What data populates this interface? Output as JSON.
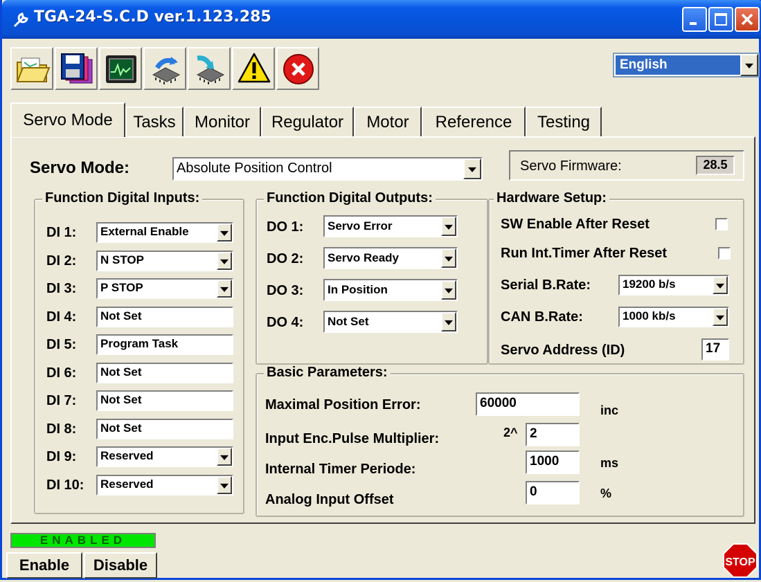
{
  "window": {
    "title": "TGA-24-S.C.D  ver.1.123.285"
  },
  "toolbar": {
    "icons": [
      "open-folder-icon",
      "save-icon",
      "scope-monitor-icon",
      "upload-chip-icon",
      "download-chip-icon",
      "warning-icon",
      "error-icon"
    ]
  },
  "language": {
    "selected": "English"
  },
  "tabs": [
    "Servo Mode",
    "Tasks",
    "Monitor",
    "Regulator",
    "Motor",
    "Reference",
    "Testing"
  ],
  "servo_mode": {
    "label": "Servo Mode:",
    "value": "Absolute Position Control",
    "firmware_label": "Servo Firmware:",
    "firmware_value": "28.5"
  },
  "digital_inputs": {
    "title": "Function Digital Inputs:",
    "items": [
      {
        "label": "DI 1:",
        "value": "External Enable",
        "type": "combo"
      },
      {
        "label": "DI 2:",
        "value": "N STOP",
        "type": "combo"
      },
      {
        "label": "DI 3:",
        "value": "P STOP",
        "type": "combo"
      },
      {
        "label": "DI 4:",
        "value": "Not Set",
        "type": "text"
      },
      {
        "label": "DI 5:",
        "value": "Program Task",
        "type": "text"
      },
      {
        "label": "DI 6:",
        "value": "Not Set",
        "type": "text"
      },
      {
        "label": "DI 7:",
        "value": "Not Set",
        "type": "text"
      },
      {
        "label": "DI 8:",
        "value": "Not Set",
        "type": "text"
      },
      {
        "label": "DI 9:",
        "value": "Reserved",
        "type": "combo"
      },
      {
        "label": "DI 10:",
        "value": "Reserved",
        "type": "combo"
      }
    ]
  },
  "digital_outputs": {
    "title": "Function Digital Outputs:",
    "items": [
      {
        "label": "DO 1:",
        "value": "Servo Error"
      },
      {
        "label": "DO 2:",
        "value": "Servo Ready"
      },
      {
        "label": "DO 3:",
        "value": "In Position"
      },
      {
        "label": "DO 4:",
        "value": "Not Set"
      }
    ]
  },
  "hardware_setup": {
    "title": "Hardware Setup:",
    "sw_enable_label": "SW Enable After Reset",
    "sw_enable_checked": false,
    "run_timer_label": "Run Int.Timer After Reset",
    "run_timer_checked": false,
    "serial_label": "Serial B.Rate:",
    "serial_value": "19200 b/s",
    "can_label": "CAN B.Rate:",
    "can_value": "1000 kb/s",
    "address_label": "Servo Address (ID)",
    "address_value": "17"
  },
  "basic_parameters": {
    "title": "Basic Parameters:",
    "max_pos_error_label": "Maximal Position Error:",
    "max_pos_error_value": "60000",
    "max_pos_error_unit": "inc",
    "enc_mult_label": "Input Enc.Pulse Multiplier:",
    "enc_mult_prefix": "2^",
    "enc_mult_value": "2",
    "timer_label": "Internal Timer Periode:",
    "timer_value": "1000",
    "timer_unit": "ms",
    "offset_label": "Analog Input Offset",
    "offset_value": "0",
    "offset_unit": "%"
  },
  "status": {
    "text": "ENABLED"
  },
  "buttons": {
    "enable": "Enable",
    "disable": "Disable",
    "stop": "STOP"
  },
  "colors": {
    "titlebar": "#0a5ae8",
    "status_green": "#00e600",
    "stop_red": "#d40000",
    "selection": "#316ac5"
  }
}
